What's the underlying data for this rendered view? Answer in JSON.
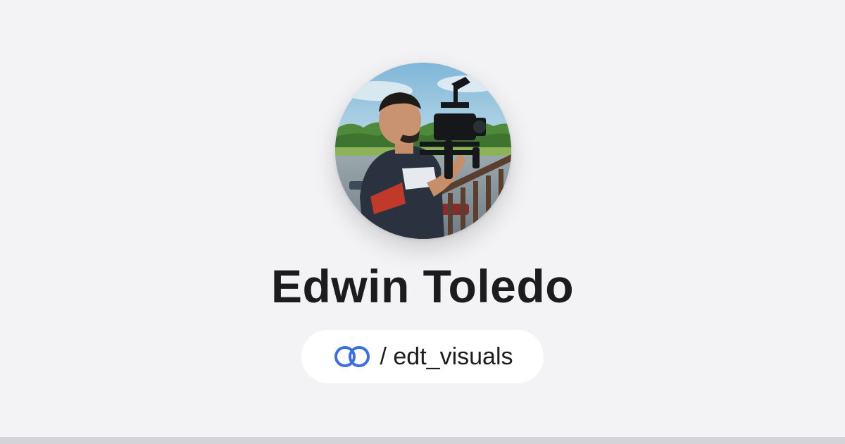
{
  "profile": {
    "name": "Edwin Toledo",
    "avatar": "profile-photo-videographer-with-camera-rig",
    "handle_separator": "/",
    "handle": "edt_visuals",
    "handle_display": "/ edt_visuals",
    "logo_icon": "linked-rings-icon"
  },
  "colors": {
    "background": "#f3f3f5",
    "name_text": "#1c1c1e",
    "pill_background": "#ffffff",
    "logo_blue": "#3b6fe0",
    "bottom_bar": "#d4d4d8"
  }
}
